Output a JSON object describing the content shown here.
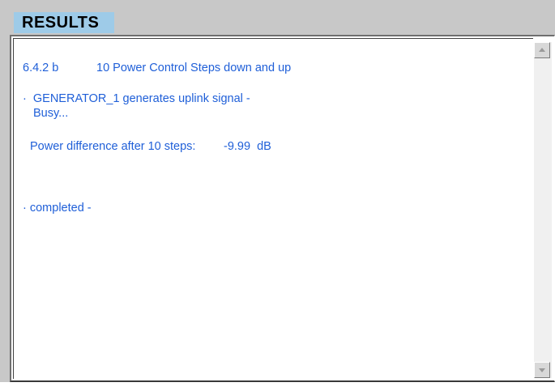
{
  "header": {
    "title": "RESULTS"
  },
  "results": {
    "test_id": "6.4.2 b",
    "test_name": "10 Power Control Steps down and up",
    "generator_line": "·  GENERATOR_1 generates uplink signal -",
    "busy_line": "Busy...",
    "power_label": "Power difference after 10 steps:",
    "power_value": "-9.99  dB",
    "completed_line": "· completed -"
  },
  "icons": {
    "scroll_up": "scroll-up-arrow-icon",
    "scroll_down": "scroll-down-arrow-icon"
  },
  "colors": {
    "text_blue": "#1f5fd8",
    "header_bg": "#9ecbe8",
    "frame_bg": "#c8c8c8"
  }
}
